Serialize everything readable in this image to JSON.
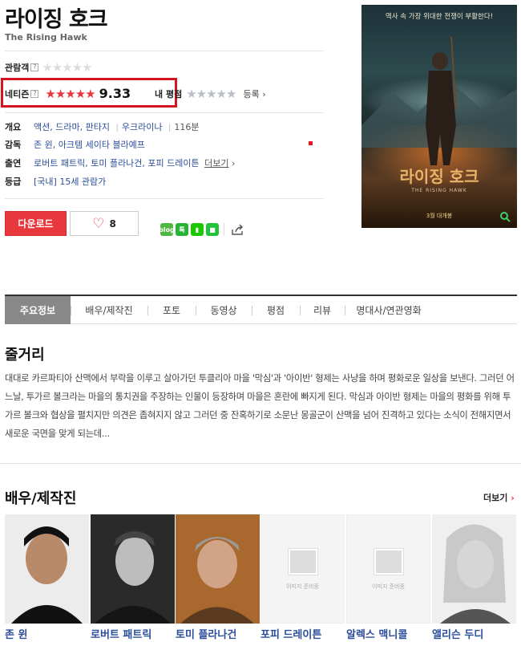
{
  "movie": {
    "title": "라이징 호크",
    "original_title": "The Rising Hawk"
  },
  "ratings": {
    "audience_label": "관람객",
    "audience_help": "?",
    "audience_stars": "★★★★★",
    "netizen_label": "네티즌",
    "netizen_help": "?",
    "netizen_stars": "★★★★★",
    "netizen_score": "9.33",
    "netizen_score_value": 9.33,
    "my_label": "내 평점",
    "my_stars": "★★★★★",
    "register": "등록"
  },
  "info": {
    "overview_label": "개요",
    "genres": [
      "액션",
      "드라마",
      "판타지"
    ],
    "country": "우크라이나",
    "runtime": "116분",
    "director_label": "감독",
    "directors": "존 윈, 아크템 세이타 블라예프",
    "cast_label": "출연",
    "cast": "로버트 패트릭, 토미 플라나건, 포피 드레이튼",
    "cast_more": "더보기",
    "grade_label": "등급",
    "grade": "[국내] 15세 관람가"
  },
  "actions": {
    "download": "다운로드",
    "like_count": "8"
  },
  "share": [
    {
      "icon": "blog-icon",
      "text": "blog",
      "color": "#4fb843"
    },
    {
      "icon": "talk-icon",
      "text": "톡",
      "color": "#28b535"
    },
    {
      "icon": "bookmark-icon",
      "text": "▮",
      "color": "#1ec800"
    },
    {
      "icon": "band-icon",
      "text": "■",
      "color": "#23c23b"
    }
  ],
  "poster": {
    "top_text": "역사 속 가장 위대한 전쟁이 부활한다!",
    "title": "라이징 호크",
    "en_title": "THE RISING HAWK",
    "release": "3월 대개봉"
  },
  "tabs": [
    "주요정보",
    "배우/제작진",
    "포토",
    "동영상",
    "평점",
    "리뷰",
    "명대사/연관영화"
  ],
  "synopsis": {
    "heading": "줄거리",
    "text": "대대로 카르파티아 산맥에서 부락을 이루고 살아가던 투클리아 마을 '막심'과 '아이반' 형제는 사냥을 하며 평화로운 일상을 보낸다. 그러던 어느날, 투가르 볼크라는 마을의 통치권을 주장하는 인물이 등장하며 마을은 혼란에 빠지게 된다. 막심과 아이반 형제는 마을의 평화를 위해 투가르 볼크와 협상을 펼치지만 의견은 좁혀지지 않고 그러던 중 잔혹하기로 소문난 몽골군이 산맥을 넘어 진격하고 있다는 소식이 전해지면서 새로운 국면을 맞게 되는데..."
  },
  "crew": {
    "heading": "배우/제작진",
    "more": "더보기",
    "placeholder": "이미지 준비중",
    "people": [
      {
        "name": "존 윈",
        "photo": "available"
      },
      {
        "name": "로버트 패트릭",
        "photo": "available"
      },
      {
        "name": "토미 플라나건",
        "photo": "available"
      },
      {
        "name": "포피 드레이튼",
        "photo": "none"
      },
      {
        "name": "알렉스 맥니콜",
        "photo": "none"
      },
      {
        "name": "앨리슨 두디",
        "photo": "available"
      }
    ]
  }
}
